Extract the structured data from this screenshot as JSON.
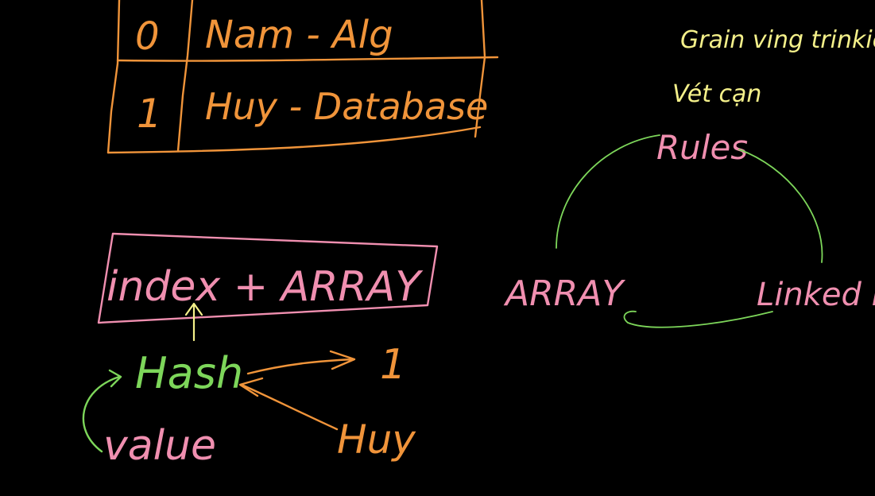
{
  "colors": {
    "background": "#000000",
    "orange": "#f0943a",
    "pink": "#f08fb0",
    "green": "#7dd65a",
    "yellow": "#f4f08a"
  },
  "table": {
    "rows": [
      {
        "index": "0",
        "value": "Nam - Alg"
      },
      {
        "index": "1",
        "value": "Huy - Database"
      }
    ]
  },
  "left_notes": {
    "index_plus_array": "index + ARRAY",
    "hash": "Hash",
    "value": "value",
    "mapped_index": "1",
    "mapped_value": "Huy"
  },
  "right_notes": {
    "line1": "Grain ving trinkien",
    "line2": "Vét cạn",
    "rules": "Rules",
    "array": "ARRAY",
    "linked_list": "Linked li"
  }
}
